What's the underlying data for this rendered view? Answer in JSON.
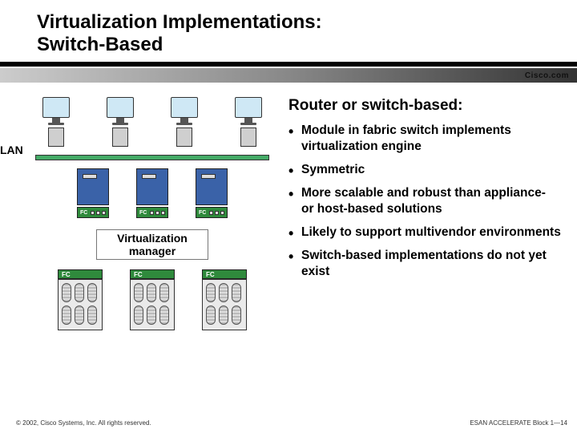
{
  "title": {
    "line1": "Virtualization Implementations:",
    "line2": "Switch-Based"
  },
  "brand": "Cisco.com",
  "subhead": "Router or switch-based:",
  "bullets": [
    "Module in fabric switch implements virtualization engine",
    "Symmetric",
    "More scalable and robust than appliance- or host-based solutions",
    "Likely to support multivendor environments",
    "Switch-based implementations do not yet exist"
  ],
  "diagram": {
    "lan_label": "LAN",
    "fc_label": "FC",
    "virt_manager": "Virtualization manager"
  },
  "footer": {
    "left": "© 2002, Cisco Systems, Inc. All rights reserved.",
    "right": "ESAN ACCELERATE Block 1—14"
  }
}
